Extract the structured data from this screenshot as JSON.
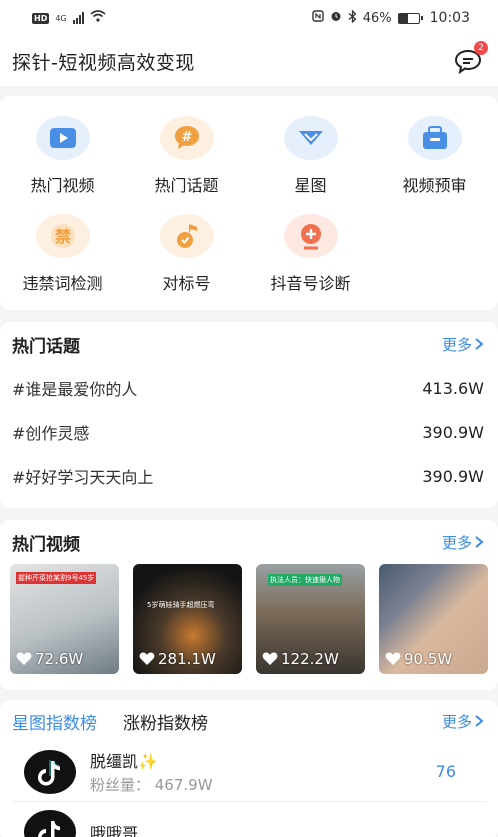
{
  "status_bar": {
    "hd": "HD",
    "network": "4G",
    "battery": "46%",
    "battery_fraction": 0.46,
    "time": "10:03"
  },
  "header": {
    "title": "探针-短视频高效变现",
    "message_badge": "2"
  },
  "tools": [
    {
      "label": "热门视频",
      "icon": "video-play-icon",
      "color": "#4a8fe6",
      "bg": "#e6f0fc"
    },
    {
      "label": "热门话题",
      "icon": "hashtag-icon",
      "color": "#f0a040",
      "bg": "#fdf0e0"
    },
    {
      "label": "星图",
      "icon": "star-chart-icon",
      "color": "#4a8fe6",
      "bg": "#e6f0fc"
    },
    {
      "label": "视频预审",
      "icon": "tv-review-icon",
      "color": "#4a8fe6",
      "bg": "#e6f0fc"
    },
    {
      "label": "违禁词检测",
      "icon": "forbidden-word-icon",
      "color": "#f0a040",
      "bg": "#fdf0e0"
    },
    {
      "label": "对标号",
      "icon": "music-note-icon",
      "color": "#f0a040",
      "bg": "#fdf0e0"
    },
    {
      "label": "抖音号诊断",
      "icon": "diagnosis-icon",
      "color": "#f07050",
      "bg": "#fde8e2"
    }
  ],
  "topics": {
    "title": "热门话题",
    "more": "更多",
    "items": [
      {
        "name": "#谁是最爱你的人",
        "count": "413.6W"
      },
      {
        "name": "#创作灵感",
        "count": "390.9W"
      },
      {
        "name": "#好好学习天天向上",
        "count": "390.9W"
      }
    ]
  },
  "videos": {
    "title": "热门视频",
    "more": "更多",
    "items": [
      {
        "likes": "72.6W",
        "caption": "握种芹菜抢某割9号45岁",
        "bg1": "#d8d8d8",
        "bg2": "#6f7b83"
      },
      {
        "likes": "281.1W",
        "caption": "5岁萌娃骑手超燃压弯",
        "bg1": "#1a1a1a",
        "bg2": "#4a3a2a"
      },
      {
        "likes": "122.2W",
        "caption": "执法人员：快速揪人物",
        "bg1": "#8a8f94",
        "bg2": "#3a3530"
      },
      {
        "likes": "90.5W",
        "caption": "",
        "bg1": "#c9a890",
        "bg2": "#4a5a70"
      }
    ]
  },
  "ranks": {
    "tabs": [
      "星图指数榜",
      "涨粉指数榜"
    ],
    "active_tab": 0,
    "more": "更多",
    "items": [
      {
        "name": "脱缰凯✨",
        "fans": "粉丝量：  467.9W",
        "score": "76"
      },
      {
        "name": "哦哦哥",
        "fans": "",
        "score": ""
      }
    ]
  }
}
